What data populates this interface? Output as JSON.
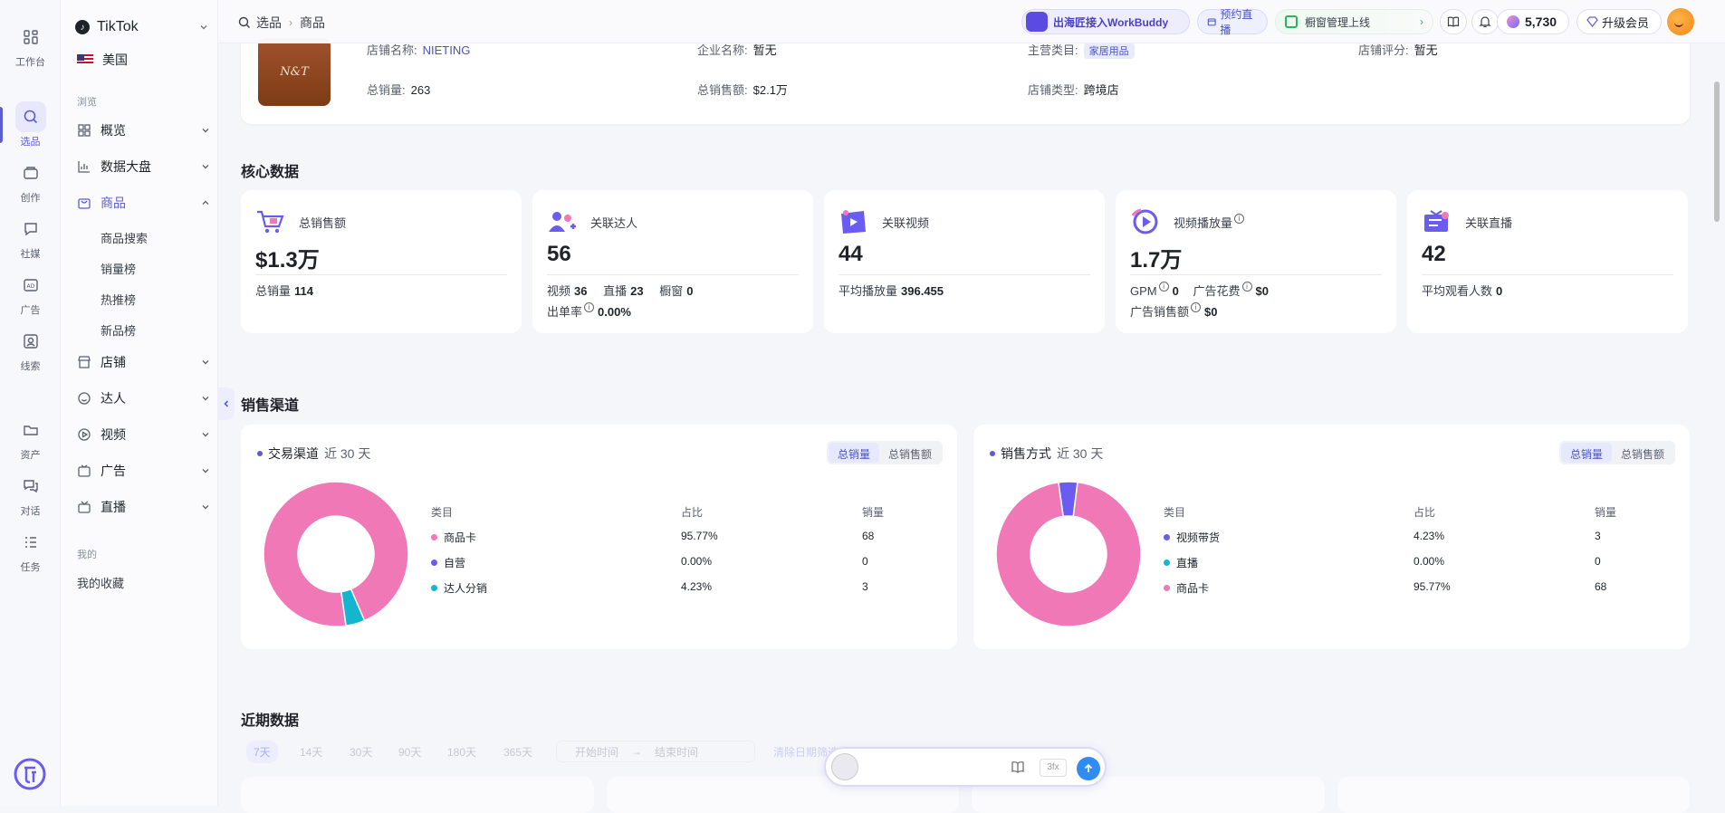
{
  "rail": [
    {
      "label": "工作台",
      "icon": "grid-icon"
    },
    {
      "label": "选品",
      "icon": "search-icon"
    },
    {
      "label": "创作",
      "icon": "create-icon"
    },
    {
      "label": "社媒",
      "icon": "chat-icon"
    },
    {
      "label": "广告",
      "icon": "ad-icon"
    },
    {
      "label": "线索",
      "icon": "contact-icon"
    },
    {
      "label": "资产",
      "icon": "folder-icon"
    },
    {
      "label": "对话",
      "icon": "dialog-icon"
    },
    {
      "label": "任务",
      "icon": "task-icon"
    }
  ],
  "nav": {
    "platform": "TikTok",
    "region": "美国",
    "section_browse": "浏览",
    "items": [
      {
        "label": "概览"
      },
      {
        "label": "数据大盘"
      },
      {
        "label": "商品"
      },
      {
        "label": "店铺"
      },
      {
        "label": "达人"
      },
      {
        "label": "视频"
      },
      {
        "label": "广告"
      },
      {
        "label": "直播"
      }
    ],
    "sub": [
      "商品搜索",
      "销量榜",
      "热推榜",
      "新品榜"
    ],
    "section_mine": "我的",
    "favorites": "我的收藏"
  },
  "topbar": {
    "crumb1": "选品",
    "crumb2": "商品",
    "workbuddy": "出海匠接入WorkBuddy",
    "live": "预约直播",
    "window": "橱窗管理上线",
    "coins": "5,730",
    "vip": "升级会员"
  },
  "store": {
    "logo_text": "N&T",
    "name_label": "店铺名称:",
    "name": "NIETING",
    "company_label": "企业名称:",
    "company": "暂无",
    "category_label": "主营类目:",
    "category": "家居用品",
    "rating_label": "店铺评分:",
    "rating": "暂无",
    "sales_label": "总销量:",
    "sales": "263",
    "gmv_label": "总销售额:",
    "gmv": "$2.1万",
    "type_label": "店铺类型:",
    "type": "跨境店"
  },
  "core": {
    "title": "核心数据",
    "cards": [
      {
        "label": "总销售额",
        "value": "$1.3万",
        "sub1_label": "总销量",
        "sub1_value": "114"
      },
      {
        "label": "关联达人",
        "value": "56",
        "a_label": "视频",
        "a_value": "36",
        "b_label": "直播",
        "b_value": "23",
        "c_label": "橱窗",
        "c_value": "0",
        "d_label": "出单率",
        "d_value": "0.00%"
      },
      {
        "label": "关联视频",
        "value": "44",
        "sub1_label": "平均播放量",
        "sub1_value": "396.455"
      },
      {
        "label": "视频播放量",
        "value": "1.7万",
        "a_label": "GPM",
        "a_value": "0",
        "b_label": "广告花费",
        "b_value": "$0",
        "c_label": "广告销售额",
        "c_value": "$0"
      },
      {
        "label": "关联直播",
        "value": "42",
        "sub1_label": "平均观看人数",
        "sub1_value": "0"
      }
    ]
  },
  "channels": {
    "title": "销售渠道",
    "cards": [
      {
        "title": "交易渠道",
        "period": "近 30 天",
        "seg": [
          "总销量",
          "总销售额"
        ],
        "head": [
          "类目",
          "占比",
          "销量"
        ],
        "rows": [
          {
            "name": "商品卡",
            "pct": "95.77%",
            "sales": "68",
            "color": "#f178b6",
            "frac": 0.9577
          },
          {
            "name": "自营",
            "pct": "0.00%",
            "sales": "0",
            "color": "#6a5cf0",
            "frac": 0
          },
          {
            "name": "达人分销",
            "pct": "4.23%",
            "sales": "3",
            "color": "#13b5cf",
            "frac": 0.0423
          }
        ]
      },
      {
        "title": "销售方式",
        "period": "近 30 天",
        "seg": [
          "总销量",
          "总销售额"
        ],
        "head": [
          "类目",
          "占比",
          "销量"
        ],
        "rows": [
          {
            "name": "视频带货",
            "pct": "4.23%",
            "sales": "3",
            "color": "#6a5cf0",
            "frac": 0.0423
          },
          {
            "name": "直播",
            "pct": "0.00%",
            "sales": "0",
            "color": "#13b5cf",
            "frac": 0
          },
          {
            "name": "商品卡",
            "pct": "95.77%",
            "sales": "68",
            "color": "#f178b6",
            "frac": 0.9577
          }
        ]
      }
    ]
  },
  "recent": {
    "title": "近期数据",
    "ranges": [
      "7天",
      "14天",
      "30天",
      "90天",
      "180天",
      "365天"
    ],
    "start": "开始时间",
    "end": "结束时间",
    "clear": "清除日期筛选"
  },
  "chat": {
    "mode": "3fx"
  },
  "colors": {
    "accent": "#5b5bd6",
    "pink": "#f178b6",
    "cyan": "#13b5cf",
    "purple": "#6a5cf0"
  }
}
